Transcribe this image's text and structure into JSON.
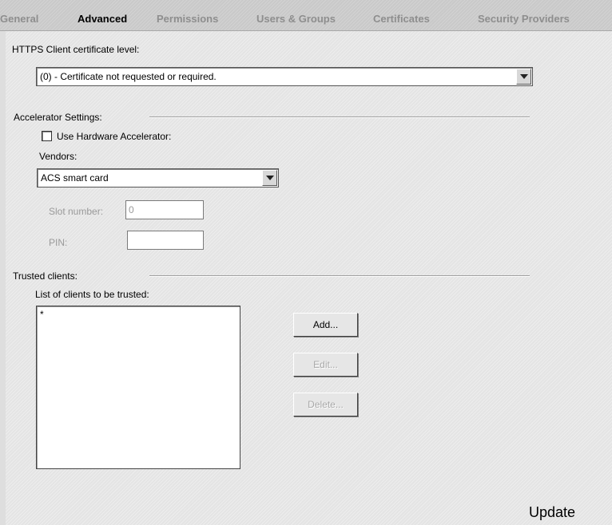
{
  "tabs": [
    {
      "label": "General"
    },
    {
      "label": "Advanced"
    },
    {
      "label": "Permissions"
    },
    {
      "label": "Users & Groups"
    },
    {
      "label": "Certificates"
    },
    {
      "label": "Security Providers"
    }
  ],
  "active_tab": "Advanced",
  "https": {
    "label": "HTTPS Client certificate level:",
    "selected": "(0) - Certificate not requested or required."
  },
  "accelerator": {
    "section_label": "Accelerator Settings:",
    "checkbox_label": "Use Hardware Accelerator:",
    "checked": false,
    "vendors_label": "Vendors:",
    "vendor_selected": "ACS smart card",
    "slot_label": "Slot number:",
    "slot_value": "0",
    "pin_label": "PIN:",
    "pin_value": ""
  },
  "trusted": {
    "section_label": "Trusted clients:",
    "list_label": "List of clients to be trusted:",
    "items": [
      "*"
    ],
    "add_label": "Add...",
    "edit_label": "Edit...",
    "delete_label": "Delete..."
  },
  "update_label": "Update",
  "colors": {
    "background": "#dedede",
    "tab_inactive": "#8e8e8e",
    "tab_active": "#000000",
    "disabled_text": "#a8a8a8"
  }
}
